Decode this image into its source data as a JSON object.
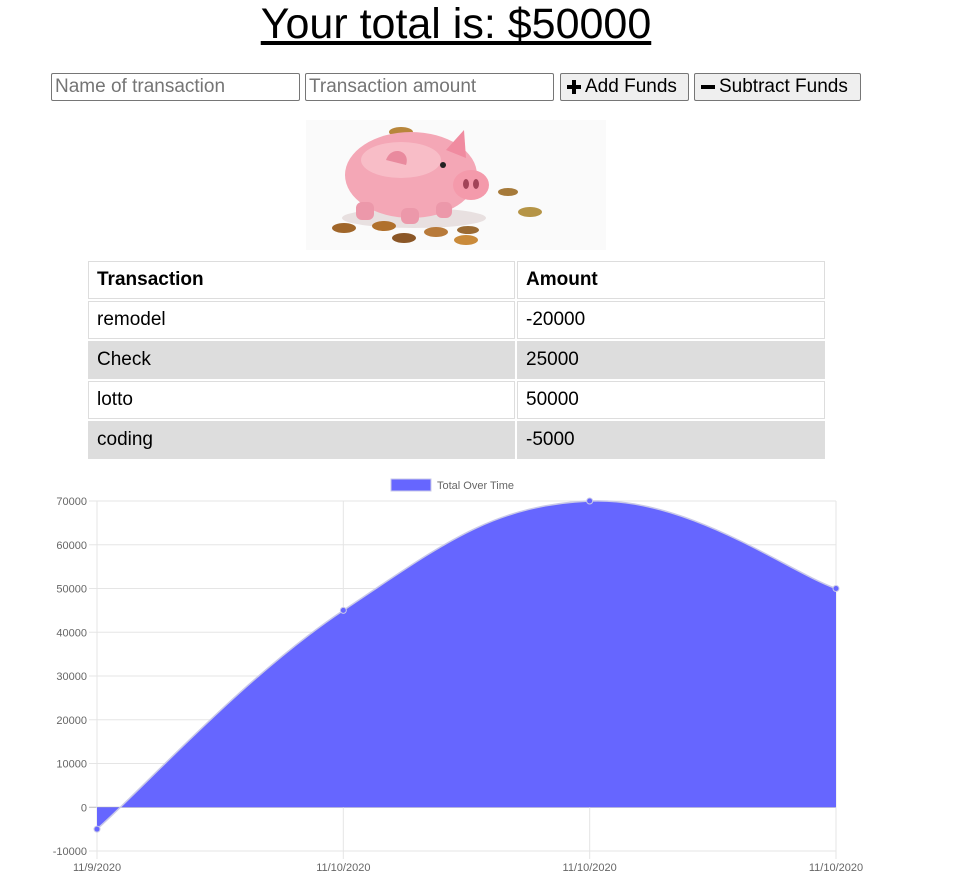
{
  "header": {
    "title": "Your total is: $50000"
  },
  "form": {
    "name_placeholder": "Name of transaction",
    "amount_placeholder": "Transaction amount",
    "add_label": "Add Funds",
    "subtract_label": "Subtract Funds"
  },
  "table": {
    "headers": [
      "Transaction",
      "Amount"
    ],
    "rows": [
      {
        "name": "remodel",
        "amount": "-20000"
      },
      {
        "name": "Check",
        "amount": "25000"
      },
      {
        "name": "lotto",
        "amount": "50000"
      },
      {
        "name": "coding",
        "amount": "-5000"
      }
    ]
  },
  "chart_data": {
    "type": "area",
    "x": [
      "11/9/2020",
      "11/10/2020",
      "11/10/2020",
      "11/10/2020"
    ],
    "series": [
      {
        "name": "Total Over Time",
        "values": [
          -5000,
          45000,
          70000,
          50000
        ],
        "color": "#6666ff"
      }
    ],
    "yticks": [
      -10000,
      0,
      10000,
      20000,
      30000,
      40000,
      50000,
      60000,
      70000
    ],
    "ylim": [
      -10000,
      70000
    ],
    "legend": "top",
    "grid": true
  }
}
